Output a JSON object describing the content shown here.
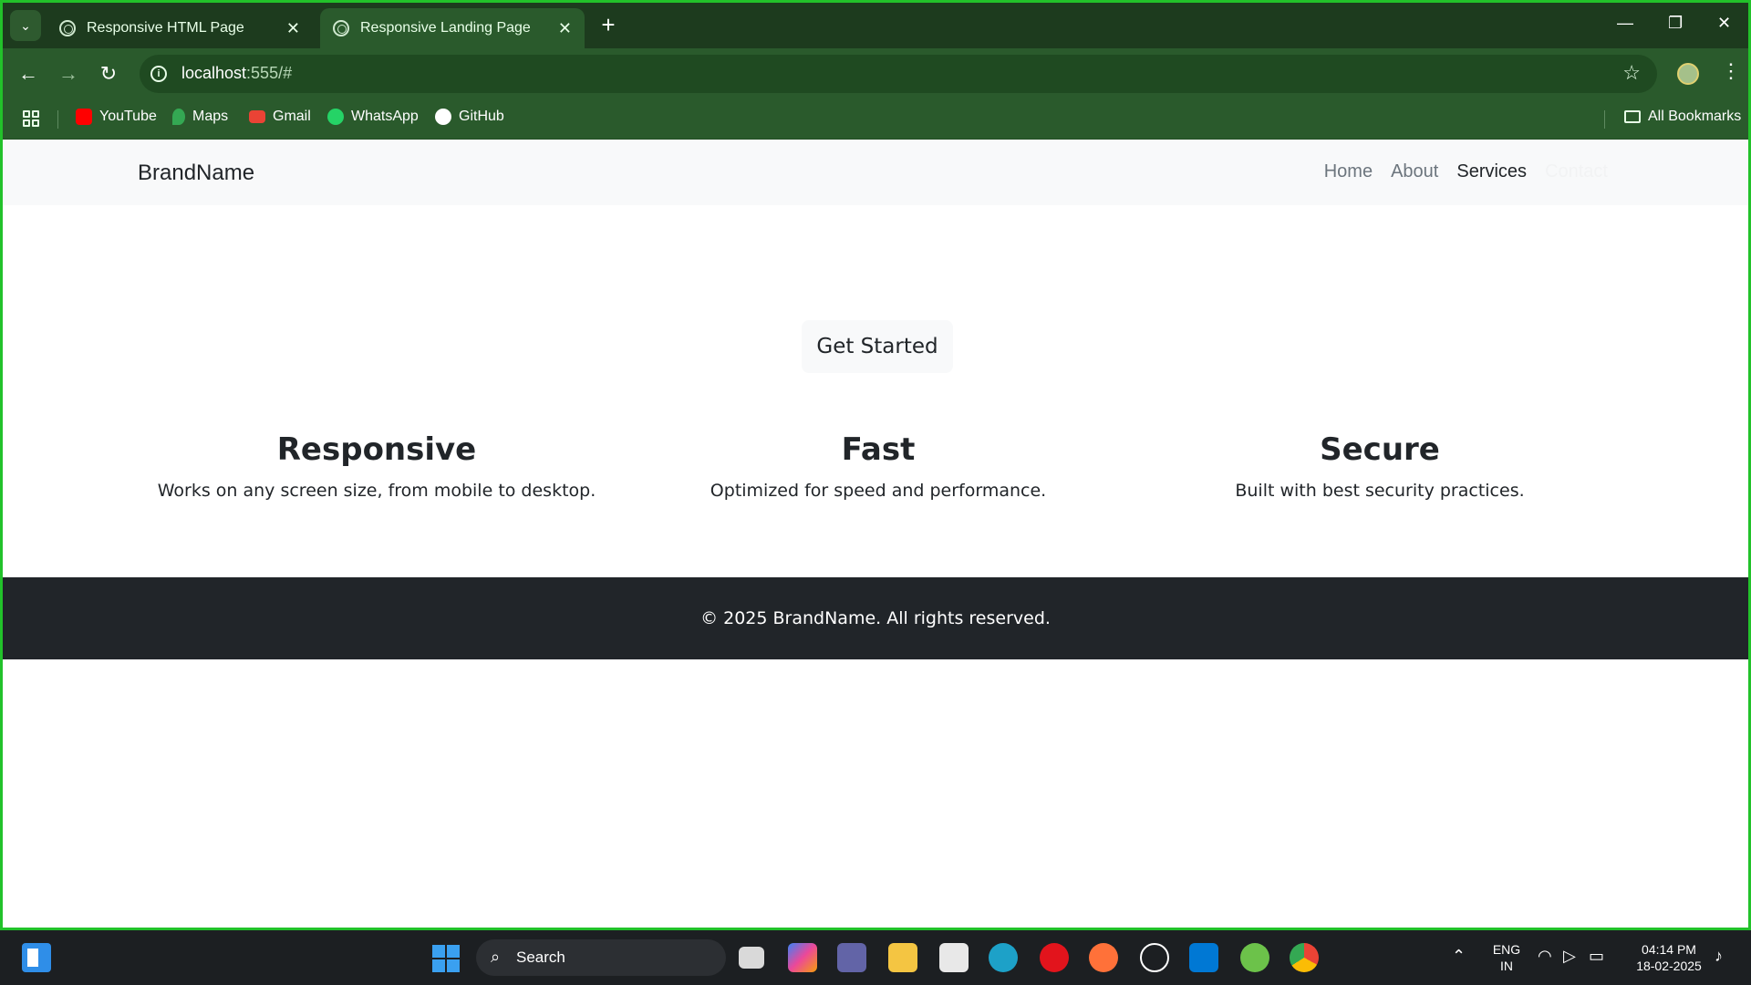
{
  "browser": {
    "tabs": [
      {
        "title": "Responsive HTML Page",
        "active": false
      },
      {
        "title": "Responsive Landing Page",
        "active": true
      }
    ],
    "url_host": "localhost",
    "url_path": ":555/#",
    "bookmarks": [
      {
        "label": "YouTube",
        "icon": "youtube-icon",
        "color": "#ff0000"
      },
      {
        "label": "Maps",
        "icon": "maps-icon",
        "color": "#34a853"
      },
      {
        "label": "Gmail",
        "icon": "gmail-icon",
        "color": "#ea4335"
      },
      {
        "label": "WhatsApp",
        "icon": "whatsapp-icon",
        "color": "#25d366"
      },
      {
        "label": "GitHub",
        "icon": "github-icon",
        "color": "#ffffff"
      }
    ],
    "all_bookmarks": "All Bookmarks"
  },
  "site": {
    "brand": "BrandName",
    "nav": [
      "Home",
      "About",
      "Services",
      "Contact"
    ],
    "cta": "Get Started",
    "features": [
      {
        "title": "Responsive",
        "text": "Works on any screen size, from mobile to desktop."
      },
      {
        "title": "Fast",
        "text": "Optimized for speed and performance."
      },
      {
        "title": "Secure",
        "text": "Built with best security practices."
      }
    ],
    "footer": "© 2025 BrandName. All rights reserved."
  },
  "taskbar": {
    "search_label": "Search",
    "lang_top": "ENG",
    "lang_bottom": "IN",
    "time": "04:14 PM",
    "date": "18-02-2025"
  },
  "colors": {
    "frame": "#22c22a",
    "chrome_dark": "#1d3b1e",
    "chrome": "#2a5a2c",
    "footer": "#212529"
  }
}
